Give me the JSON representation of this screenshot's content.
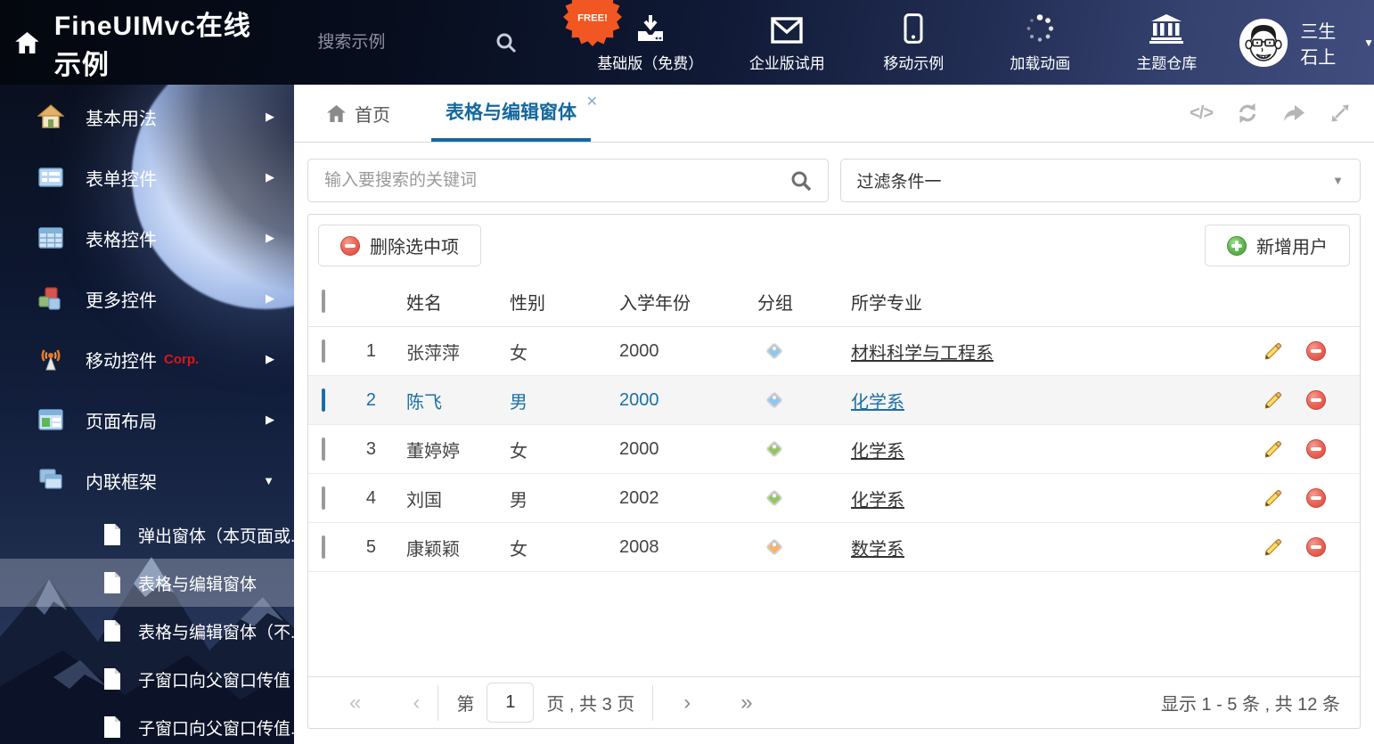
{
  "header": {
    "title": "FineUIMvc在线示例",
    "search_placeholder": "搜索示例",
    "free_badge": "FREE!",
    "nav_items": [
      {
        "icon": "download-icon",
        "label": "基础版（免费）"
      },
      {
        "icon": "envelope-icon",
        "label": "企业版试用"
      },
      {
        "icon": "mobile-icon",
        "label": "移动示例"
      },
      {
        "icon": "spinner-icon",
        "label": "加载动画"
      },
      {
        "icon": "bank-icon",
        "label": "主题仓库"
      }
    ],
    "user_name": "三生石上"
  },
  "sidebar": {
    "items": [
      {
        "icon": "home-icon",
        "label": "基本用法"
      },
      {
        "icon": "form-icon",
        "label": "表单控件"
      },
      {
        "icon": "table-icon",
        "label": "表格控件"
      },
      {
        "icon": "cubes-icon",
        "label": "更多控件"
      },
      {
        "icon": "antenna-icon",
        "label": "移动控件",
        "badge": "Corp."
      },
      {
        "icon": "layout-icon",
        "label": "页面布局"
      },
      {
        "icon": "frames-icon",
        "label": "内联框架"
      }
    ],
    "subitems": [
      {
        "label": "弹出窗体（本页面或..."
      },
      {
        "label": "表格与编辑窗体"
      },
      {
        "label": "表格与编辑窗体（不..."
      },
      {
        "label": "子窗口向父窗口传值"
      },
      {
        "label": "子窗口向父窗口传值..."
      }
    ]
  },
  "tabs": {
    "home": "首页",
    "active": "表格与编辑窗体",
    "close_glyph": "✕"
  },
  "filters": {
    "search_placeholder": "输入要搜索的关键词",
    "dropdown_value": "过滤条件一"
  },
  "toolbar": {
    "delete_label": "删除选中项",
    "add_label": "新增用户"
  },
  "table": {
    "columns": {
      "name": "姓名",
      "gender": "性别",
      "year": "入学年份",
      "group": "分组",
      "major": "所学专业"
    },
    "rows": [
      {
        "index": "1",
        "name": "张萍萍",
        "gender": "女",
        "year": "2000",
        "tag_color": "#8ec7f0",
        "major": "材料科学与工程系"
      },
      {
        "index": "2",
        "name": "陈飞",
        "gender": "男",
        "year": "2000",
        "tag_color": "#8ec7f0",
        "major": "化学系"
      },
      {
        "index": "3",
        "name": "董婷婷",
        "gender": "女",
        "year": "2000",
        "tag_color": "#93c65c",
        "major": "化学系"
      },
      {
        "index": "4",
        "name": "刘国",
        "gender": "男",
        "year": "2002",
        "tag_color": "#93c65c",
        "major": "化学系"
      },
      {
        "index": "5",
        "name": "康颖颖",
        "gender": "女",
        "year": "2008",
        "tag_color": "#f8b express",
        "major": "数学系"
      }
    ],
    "selected_row_index": 2
  },
  "pagination": {
    "first_glyph": "«",
    "prev_glyph": "‹",
    "page_prefix": "第",
    "current_page": "1",
    "page_suffix": "页 , 共 3 页",
    "next_glyph": "›",
    "last_glyph": "»",
    "summary": "显示 1 - 5 条 , 共 12 条"
  },
  "colors": {
    "accent_blue": "#15689e",
    "link_blue": "#1b6fa8",
    "delete_red": "#dd4437",
    "add_green": "#47a238",
    "corp_red": "#e01515",
    "free_orange": "#f25622"
  }
}
